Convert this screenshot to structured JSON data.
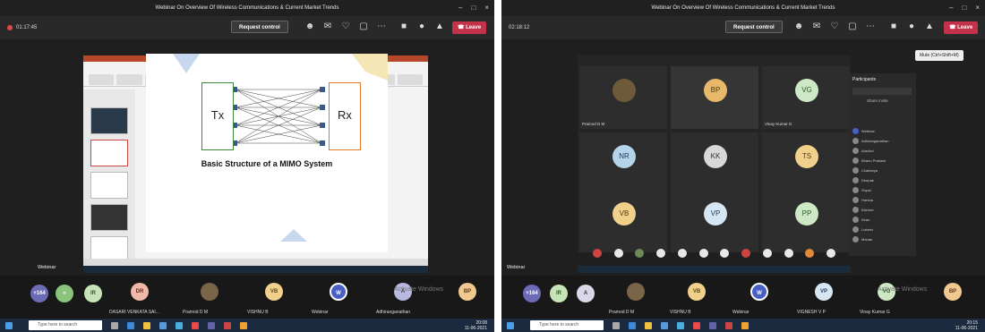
{
  "left": {
    "title": "Webinar On Overview Of Wireless Communications & Current Market Trends",
    "timer": "01:17:45",
    "request_control": "Request control",
    "leave": "Leave",
    "slide_caption": "Basic Structure of a MIMO System",
    "tx_label": "Tx",
    "rx_label": "Rx",
    "webinar_label": "Webinar",
    "tiles": [
      {
        "initials": "+164",
        "name": ""
      },
      {
        "initials": "",
        "name": ""
      },
      {
        "initials": "IR",
        "name": ""
      },
      {
        "initials": "DR",
        "name": "DASARI VENKATA SAI..."
      },
      {
        "initials": "",
        "name": "Pramod D M"
      },
      {
        "initials": "VB",
        "name": "VISHNU B"
      },
      {
        "initials": "W",
        "name": "Webinar"
      },
      {
        "initials": "A",
        "name": "Adhiranganathan"
      },
      {
        "initials": "BP",
        "name": ""
      }
    ],
    "search_placeholder": "Type here to search",
    "clock_time": "20:08",
    "clock_date": "11-06-2021",
    "watermark": "Activate Windows"
  },
  "right": {
    "title": "Webinar On Overview Of Wireless Communications & Current Market Trends",
    "timer": "02:18:12",
    "request_control": "Request control",
    "leave": "Leave",
    "tooltip": "Mute (Ctrl+Shift+M)",
    "gallery": [
      {
        "initials": "",
        "name": "Pramod D M",
        "color": "#6e5a3a"
      },
      {
        "initials": "BP",
        "name": "",
        "color": "#e8b86a"
      },
      {
        "initials": "VG",
        "name": "Vinay Kumar G",
        "color": "#cde8c4"
      },
      {
        "initials": "NR",
        "name": "",
        "color": "#b4d4ea"
      },
      {
        "initials": "KK",
        "name": "",
        "color": "#d8d8d8"
      },
      {
        "initials": "TS",
        "name": "",
        "color": "#f0d08a"
      },
      {
        "initials": "VB",
        "name": "",
        "color": "#f0d08a"
      },
      {
        "initials": "VP",
        "name": "",
        "color": "#d6e6f2"
      },
      {
        "initials": "PP",
        "name": "",
        "color": "#cde8c4"
      }
    ],
    "participants_header": "Participants",
    "share_link": "Share invite",
    "participants": [
      "Webinar",
      "Adhiranganathan",
      "Aravind",
      "Bhanu Prakash",
      "Chaitanya",
      "Deepak",
      "Gopal",
      "Harsha",
      "Kishore",
      "Kiran",
      "Lokesh",
      "Mohan"
    ],
    "tiles": [
      {
        "initials": "+164",
        "name": ""
      },
      {
        "initials": "IR",
        "name": ""
      },
      {
        "initials": "A",
        "name": ""
      },
      {
        "initials": "",
        "name": "Pramod D M"
      },
      {
        "initials": "VB",
        "name": "VISHNU B"
      },
      {
        "initials": "W",
        "name": "Webinar"
      },
      {
        "initials": "VP",
        "name": "VIGNESH V P"
      },
      {
        "initials": "VG",
        "name": "Vinay Kumar G"
      },
      {
        "initials": "BP",
        "name": ""
      }
    ],
    "webinar_label": "Webinar",
    "search_placeholder": "Type here to search",
    "clock_time": "20:15",
    "clock_date": "11-06-2021",
    "watermark": "Activate Windows"
  }
}
